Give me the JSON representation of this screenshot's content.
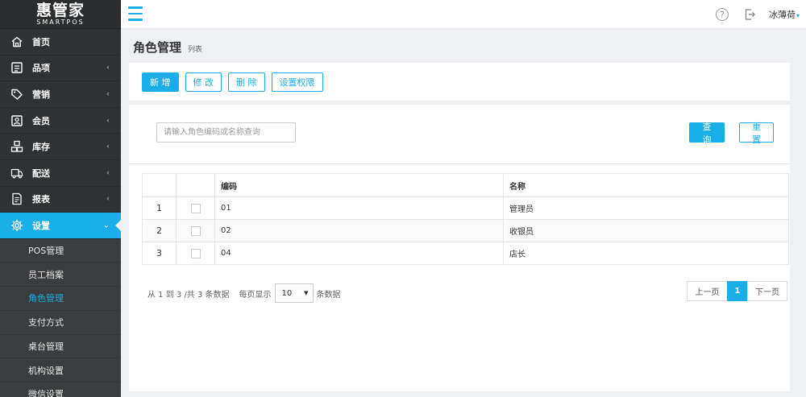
{
  "app": {
    "logo_main": "惠管家",
    "logo_sub": "SMARTPOS"
  },
  "sidebar": {
    "items": [
      {
        "label": "首页",
        "icon": "home-icon",
        "expandable": false
      },
      {
        "label": "品项",
        "icon": "list-icon",
        "expandable": true
      },
      {
        "label": "营销",
        "icon": "tag-icon",
        "expandable": true
      },
      {
        "label": "会员",
        "icon": "member-card-icon",
        "expandable": true
      },
      {
        "label": "库存",
        "icon": "inventory-icon",
        "expandable": true
      },
      {
        "label": "配送",
        "icon": "truck-icon",
        "expandable": true
      },
      {
        "label": "报表",
        "icon": "report-icon",
        "expandable": true
      },
      {
        "label": "设置",
        "icon": "gear-icon",
        "expandable": true,
        "active": true
      }
    ],
    "chevron_collapsed": "‹",
    "chevron_expanded": "⌄",
    "submenu": [
      {
        "label": "POS管理"
      },
      {
        "label": "员工档案"
      },
      {
        "label": "角色管理",
        "active": true
      },
      {
        "label": "支付方式"
      },
      {
        "label": "桌台管理"
      },
      {
        "label": "机构设置"
      },
      {
        "label": "微信设置"
      }
    ]
  },
  "header": {
    "help_icon": "?",
    "username": "冰薄荷",
    "caret": "▾"
  },
  "page": {
    "title": "角色管理",
    "subtitle": "列表"
  },
  "toolbar": {
    "add_label": "新 增",
    "edit_label": "修 改",
    "delete_label": "删 除",
    "permission_label": "设置权限"
  },
  "search": {
    "placeholder": "请输入角色编码或名称查询",
    "query_label": "查 询",
    "reset_label": "重 置"
  },
  "table": {
    "headers": {
      "index": "",
      "check": "",
      "code": "编码",
      "name": "名称"
    },
    "rows": [
      {
        "index": "1",
        "code": "01",
        "name": "管理员"
      },
      {
        "index": "2",
        "code": "02",
        "name": "收银员"
      },
      {
        "index": "3",
        "code": "04",
        "name": "店长"
      }
    ]
  },
  "pagination": {
    "summary": "从 1 到 3 /共 3 条数据",
    "per_page_label": "每页显示",
    "page_size": "10",
    "per_page_suffix": "条数据",
    "prev_label": "上一页",
    "current_page": "1",
    "next_label": "下一页"
  },
  "colors": {
    "accent": "#1aaee8",
    "sidebar_bg": "#2f3133",
    "page_bg": "#eef0f3"
  }
}
